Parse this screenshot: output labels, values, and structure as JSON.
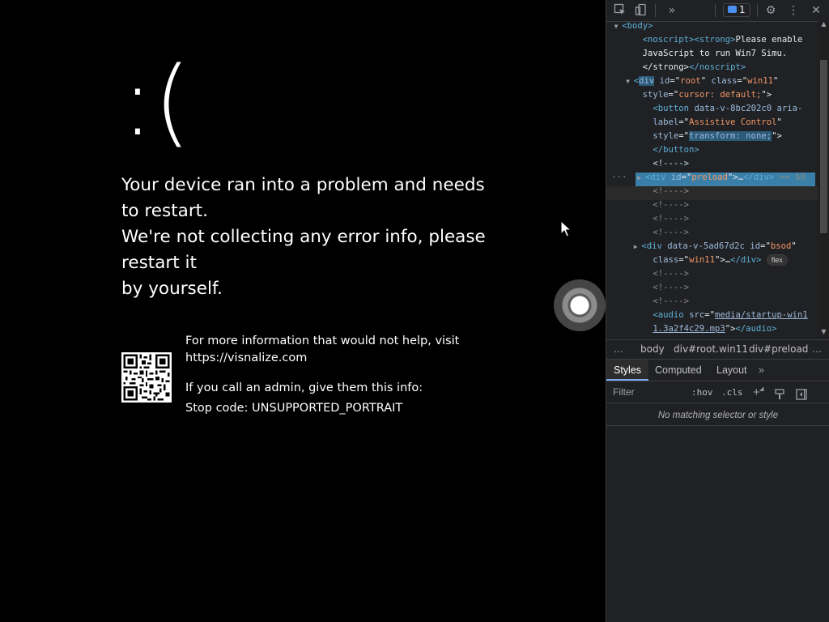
{
  "bsod": {
    "sad_face": ":(",
    "message_lines": [
      "Your device ran into a problem and needs",
      "to restart.",
      "We're not collecting any error info, please",
      "restart it",
      "by yourself."
    ],
    "info_line1": "For more information that would not help, visit",
    "info_url": "https://visnalize.com",
    "info_admin": "If you call an admin, give them this info:",
    "stop_code": "Stop code: UNSUPPORTED_PORTRAIT"
  },
  "devtools": {
    "issues_count": "1",
    "dom_tree": {
      "body_open": "<body>",
      "noscript_line1": "Please enable",
      "noscript_line2": "JavaScript to run Win7 Simu.",
      "root_id": "root",
      "root_class": "win11",
      "root_style": "cursor: default;",
      "button_attr": "data-v-8bc202c0",
      "button_label_value": "Assistive Control",
      "button_style_value": "transform: none;",
      "comment": "<!---->",
      "preload_id": "preload",
      "selected_marker": "== $0",
      "bsod_attr": "data-v-5ad67d2c",
      "bsod_id": "bsod",
      "bsod_class": "win11",
      "flex_badge": "flex",
      "audio_src_part1": "media/startup-win1",
      "audio_src_part2": "1.3a2f4c29.mp3"
    },
    "breadcrumbs": [
      "body",
      "div#root.win11",
      "div#preload"
    ],
    "tabs": [
      "Styles",
      "Computed",
      "Layout"
    ],
    "filter_placeholder": "Filter",
    "hov_toggle": ":hov",
    "cls_toggle": ".cls",
    "no_match_text": "No matching selector or style"
  }
}
